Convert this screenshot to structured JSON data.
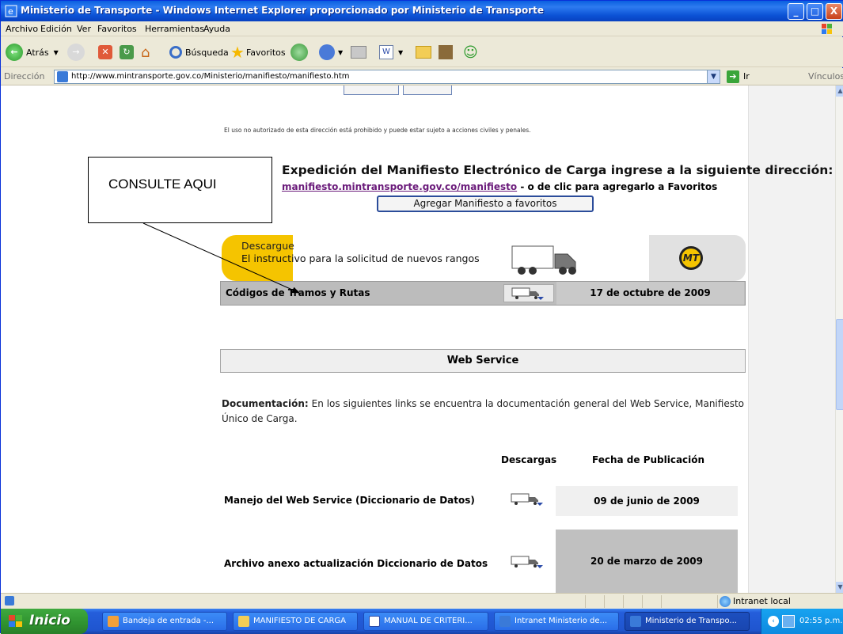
{
  "window": {
    "title": "Ministerio de Transporte - Windows Internet Explorer proporcionado por Ministerio de Transporte",
    "min_label": "_",
    "max_label": "□",
    "close_label": "X"
  },
  "menu": [
    "Archivo",
    "Edición",
    "Ver",
    "Favoritos",
    "Herramientas",
    "Ayuda"
  ],
  "toolbar": {
    "back": "Atrás",
    "search": "Búsqueda",
    "favorites": "Favoritos"
  },
  "address": {
    "label": "Dirección",
    "url": "http://www.mintransporte.gov.co/Ministerio/manifiesto/manifiesto.htm",
    "go": "Ir",
    "links": "Vínculos"
  },
  "page": {
    "warning": "El uso no autorizado de esta dirección está prohibido y puede estar sujeto a acciones civiles y penales.",
    "expedition_line1": "Expedición del Manifiesto Electrónico de Carga ingrese a la siguiente dirección:",
    "expedition_link": "manifiesto.mintransporte.gov.co/manifiesto",
    "expedition_suffix": " - o de clic para agregarlo a Favoritos",
    "fav_button": "Agregar Manifiesto a favoritos",
    "callout": "CONSULTE AQUI",
    "banner_title": "Descargue",
    "banner_text": "El instructivo para la solicitud de nuevos rangos",
    "banner_logo": "MT",
    "codes_label": "Códigos de Tramos y Rutas",
    "codes_date": "17 de octubre de 2009",
    "ws_header": "Web Service",
    "doc_bold": "Documentación:",
    "doc_text": " En los siguientes links se encuentra la documentación general del Web Service, Manifiesto Único de Carga.",
    "col_downloads": "Descargas",
    "col_date": "Fecha de Publicación",
    "rows": [
      {
        "label": "Manejo del Web Service (Diccionario de Datos)",
        "date": "09 de junio de 2009"
      },
      {
        "label": "Archivo anexo actualización Diccionario de Datos",
        "date": "20 de marzo de 2009"
      }
    ]
  },
  "statusbar": {
    "zone": "Intranet local"
  },
  "taskbar": {
    "start": "Inicio",
    "tasks": [
      "Bandeja de entrada -...",
      "MANIFIESTO DE CARGA",
      "MANUAL DE CRITERI...",
      "Intranet Ministerio de...",
      "Ministerio de Transpo..."
    ],
    "time": "02:55 p.m."
  },
  "colors": {
    "title_blue": "#0c53d6",
    "banner_yellow": "#f5c400",
    "row_gray": "#bcbcbc",
    "link_purple": "#6a1a7a",
    "start_green": "#2f922f"
  }
}
